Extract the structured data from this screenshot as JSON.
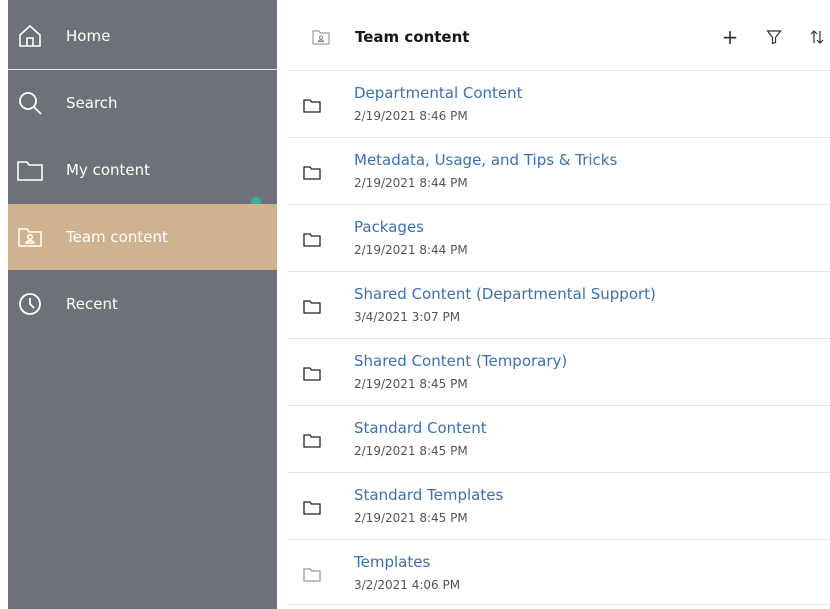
{
  "sidebar": {
    "items": [
      {
        "label": "Home",
        "icon": "home-icon"
      },
      {
        "label": "Search",
        "icon": "search-icon"
      },
      {
        "label": "My content",
        "icon": "folder-icon"
      },
      {
        "label": "Team content",
        "icon": "team-folder-icon",
        "selected": true
      },
      {
        "label": "Recent",
        "icon": "clock-icon"
      }
    ],
    "colors": {
      "background": "#6f7179",
      "selected": "#cfb38f",
      "status_dot": "#2db3a0"
    }
  },
  "header": {
    "title": "Team content",
    "icons": [
      "add-icon",
      "filter-icon",
      "sort-icon"
    ]
  },
  "items": [
    {
      "name": "Departmental Content",
      "date": "2/19/2021 8:46 PM"
    },
    {
      "name": "Metadata, Usage, and Tips & Tricks",
      "date": "2/19/2021 8:44 PM"
    },
    {
      "name": "Packages",
      "date": "2/19/2021 8:44 PM"
    },
    {
      "name": "Shared Content (Departmental Support)",
      "date": "3/4/2021 3:07 PM"
    },
    {
      "name": "Shared Content (Temporary)",
      "date": "2/19/2021 8:45 PM"
    },
    {
      "name": "Standard Content",
      "date": "2/19/2021 8:45 PM"
    },
    {
      "name": "Standard Templates",
      "date": "2/19/2021 8:45 PM"
    },
    {
      "name": "Templates",
      "date": "3/2/2021 4:06 PM"
    }
  ],
  "link_color": "#3b6fb6"
}
